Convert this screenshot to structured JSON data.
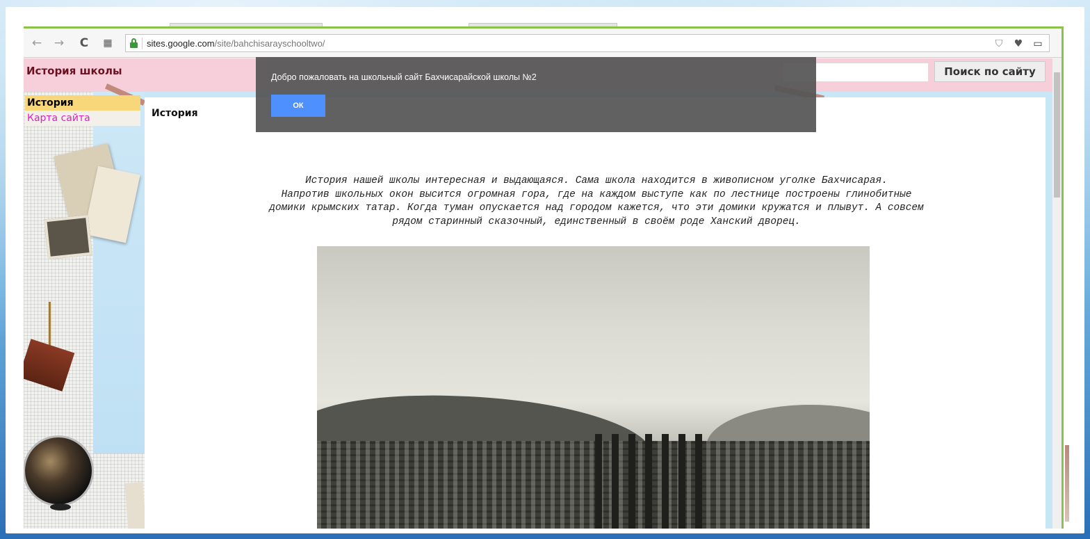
{
  "browser": {
    "url_host": "sites.google.com",
    "url_path": "/site/bahchisarayschooltwo/",
    "nav_icons": [
      "back-arrow-icon",
      "forward-arrow-icon",
      "reload-icon",
      "apps-grid-icon"
    ],
    "right_icons": [
      "shield-icon",
      "heart-icon",
      "battery-icon"
    ]
  },
  "site": {
    "title": "История школы",
    "search_button": "Поиск по сайту",
    "search_placeholder": ""
  },
  "sidebar": {
    "items": [
      {
        "label": "История",
        "active": true
      },
      {
        "label": "Карта сайта",
        "active": false
      }
    ]
  },
  "notice": {
    "text": "Добро пожаловать на школьный сайт Бахчисарайской школы №2",
    "button": "ОК"
  },
  "main": {
    "heading": "История",
    "paragraph_lines": [
      "История нашей школы интересная и выдающаяся. Сама школа находится в живописном уголке Бахчисарая.",
      "Напротив школьных окон высится огромная гора, где на каждом выступе как по лестнице построены глинобитные",
      "домики крымских татар. Когда туман опускается над городом кажется, что эти домики кружатся и плывут. А совсем",
      "рядом старинный сказочный, единственный в своём роде Ханский дворец."
    ]
  },
  "colors": {
    "header_bg": "#f6cfdb",
    "title_color": "#6b1020",
    "nav_active_bg": "#f7d77a",
    "nav_link_color": "#e020c0",
    "notice_bg": "#555555",
    "notice_button": "#4d90fe",
    "browser_accent": "#8bc34a"
  }
}
